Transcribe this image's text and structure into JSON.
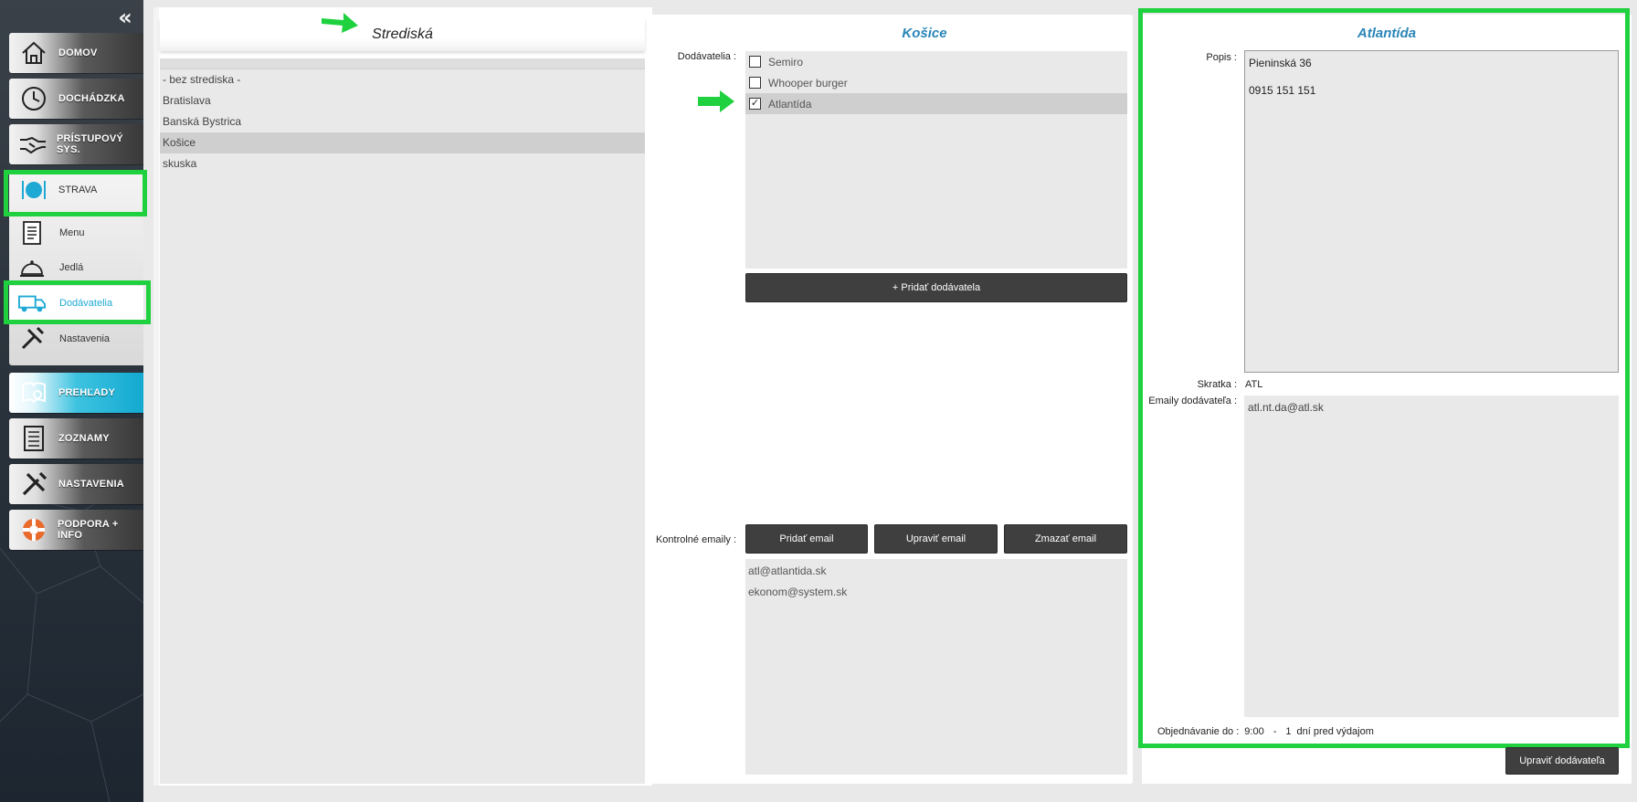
{
  "sidebar": {
    "collapse_glyph": "«",
    "nav": [
      {
        "label": "DOMOV",
        "icon": "home-icon"
      },
      {
        "label": "DOCHÁDZKA",
        "icon": "clock-icon"
      },
      {
        "label": "PRÍSTUPOVÝ SYS.",
        "icon": "handshake-icon"
      },
      {
        "label": "STRAVA",
        "icon": "plate-cutlery-icon"
      },
      {
        "label": "PREHĽADY",
        "icon": "reports-icon"
      },
      {
        "label": "ZOZNAMY",
        "icon": "list-icon"
      },
      {
        "label": "NASTAVENIA",
        "icon": "tools-icon"
      },
      {
        "label": "PODPORA + INFO",
        "icon": "lifebuoy-icon"
      }
    ],
    "strava_sub": [
      {
        "label": "Menu",
        "icon": "menu-document-icon"
      },
      {
        "label": "Jedlá",
        "icon": "cloche-icon"
      },
      {
        "label": "Dodávatelia",
        "icon": "truck-icon"
      },
      {
        "label": "Nastavenia",
        "icon": "wrench-icon"
      }
    ],
    "active_color": "#12a9d1"
  },
  "strediska": {
    "title": "Strediská",
    "items": [
      "- bez strediska -",
      "Bratislava",
      "Banská Bystrica",
      "Košice",
      "skuska"
    ],
    "selected_index": 3
  },
  "kosice": {
    "title": "Košice",
    "suppliers_label": "Dodávatelia :",
    "suppliers": [
      {
        "name": "Semiro",
        "checked": false
      },
      {
        "name": "Whooper burger",
        "checked": false
      },
      {
        "name": "Atlantída",
        "checked": true
      }
    ],
    "add_supplier": "+ Pridať dodávatela",
    "control_emails_label": "Kontrolné emaily :",
    "email_buttons": [
      "Pridať email",
      "Upraviť email",
      "Zmazať email"
    ],
    "control_emails": [
      "atl@atlantida.sk",
      "ekonom@system.sk"
    ]
  },
  "atlantida": {
    "title": "Atlantída",
    "popis_label": "Popis :",
    "popis_lines": [
      "Pieninská 36",
      "",
      "0915 151 151"
    ],
    "skratka_label": "Skratka :",
    "skratka": "ATL",
    "emails_label": "Emaily dodávateľa :",
    "emails": "atl.nt.da@atl.sk",
    "order_label": "Objednávanie do :",
    "order_time": "9:00",
    "order_dash": "-",
    "order_days": "1",
    "order_suffix": "dní pred výdajom",
    "edit_button": "Upraviť dodávateľa"
  },
  "colors": {
    "highlight": "#1fd13f",
    "title_blue": "#2a86b8",
    "dark_button": "#3f3f3f"
  }
}
